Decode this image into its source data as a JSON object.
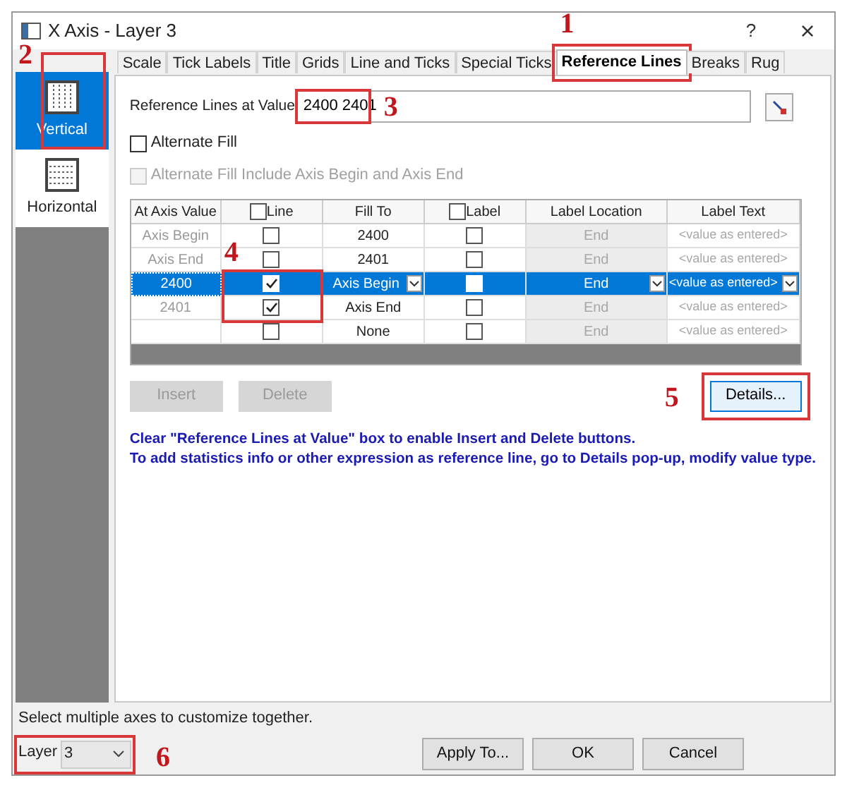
{
  "window": {
    "title": "X Axis - Layer 3",
    "help": "?",
    "close": "×"
  },
  "sidebar": {
    "items": [
      {
        "label": "Vertical",
        "selected": true,
        "marker": "2"
      },
      {
        "label": "Horizontal",
        "selected": false
      }
    ]
  },
  "tabs": [
    {
      "label": "Scale",
      "selected": false
    },
    {
      "label": "Tick Labels",
      "selected": false
    },
    {
      "label": "Title",
      "selected": false
    },
    {
      "label": "Grids",
      "selected": false
    },
    {
      "label": "Line and Ticks",
      "selected": false
    },
    {
      "label": "Special Ticks",
      "selected": false
    },
    {
      "label": "Reference Lines",
      "selected": true,
      "marker": "1"
    },
    {
      "label": "Breaks",
      "selected": false
    },
    {
      "label": "Rug",
      "selected": false
    }
  ],
  "reference_value": {
    "label": "Reference Lines at Value",
    "value": "2400 2401",
    "marker": "3"
  },
  "options": [
    {
      "label": "Alternate Fill",
      "checked": false,
      "disabled": false
    },
    {
      "label": "Alternate Fill Include Axis Begin and Axis End",
      "checked": false,
      "disabled": true
    }
  ],
  "table": {
    "columns": [
      {
        "label": "At Axis Value",
        "kind": "text"
      },
      {
        "label": "Line",
        "kind": "checkbox",
        "checked": false
      },
      {
        "label": "Fill To",
        "kind": "text"
      },
      {
        "label": "Label",
        "kind": "checkbox",
        "checked": false
      },
      {
        "label": "Label Location",
        "kind": "text"
      },
      {
        "label": "Label Text",
        "kind": "text"
      }
    ],
    "line_marker": "4",
    "rows": [
      {
        "value": "Axis Begin",
        "line": false,
        "fill_to": "2400",
        "label": false,
        "label_location": "End",
        "label_text": "<value as entered>",
        "selected": false
      },
      {
        "value": "Axis End",
        "line": false,
        "fill_to": "2401",
        "label": false,
        "label_location": "End",
        "label_text": "<value as entered>",
        "selected": false
      },
      {
        "value": "2400",
        "line": true,
        "fill_to": "Axis Begin",
        "label": false,
        "label_location": "End",
        "label_text": "<value as entered>",
        "selected": true
      },
      {
        "value": "2401",
        "line": true,
        "fill_to": "Axis End",
        "label": false,
        "label_location": "End",
        "label_text": "<value as entered>",
        "selected": false
      },
      {
        "line": false,
        "fill_to": "None",
        "label": false,
        "label_location": "End",
        "label_text": "<value as entered>",
        "selected": false
      }
    ]
  },
  "row_buttons": [
    {
      "label": "Insert",
      "disabled": true
    },
    {
      "label": "Delete",
      "disabled": true
    }
  ],
  "details_button": {
    "label": "Details...",
    "marker": "5"
  },
  "notes": [
    "Clear \"Reference Lines at Value\" box to enable Insert and Delete buttons.",
    "To add statistics info or other expression as reference line, go to Details pop-up, modify value type."
  ],
  "footer": {
    "hint": "Select multiple axes to customize together.",
    "layer_label": "Layer",
    "layer_value": "3",
    "marker": "6",
    "buttons": [
      "Apply To...",
      "OK",
      "Cancel"
    ]
  }
}
